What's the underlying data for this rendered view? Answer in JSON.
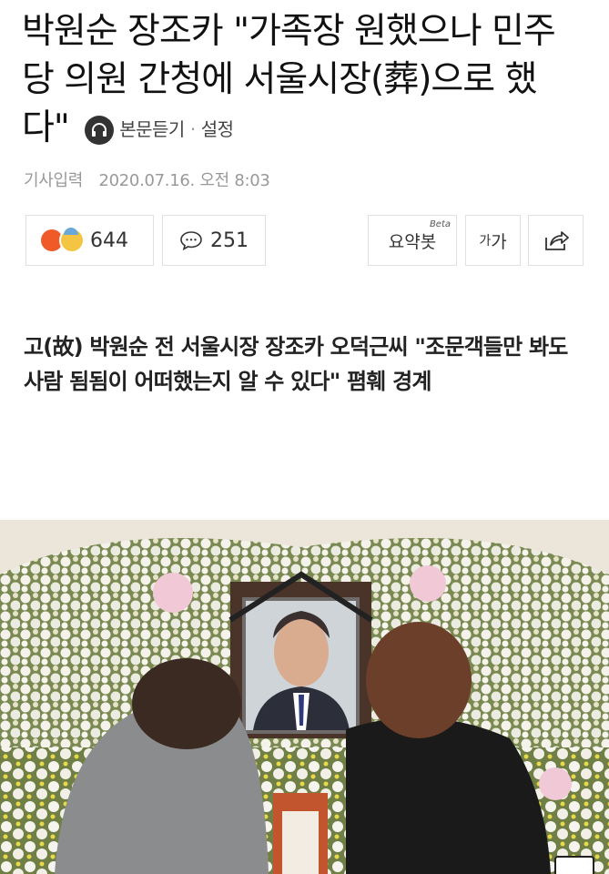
{
  "headline": {
    "line1": "박원순 장조카 \"가족장 원했으나 민주",
    "line2": "당 의원 간청에 서울시장(葬)으로 했",
    "line3": "다\"",
    "listen_label": "본문듣기",
    "dot": "·",
    "settings_label": "설정"
  },
  "meta": {
    "published_label": "기사입력",
    "published_date": "2020.07.16. 오전 8:03"
  },
  "actions": {
    "reaction_count": "644",
    "comment_count": "251",
    "summary_label": "요약봇",
    "summary_badge": "Beta",
    "fontsize_small": "가",
    "fontsize_large": "가"
  },
  "article": {
    "subtitle": "고(故) 박원순 전 서울시장 장조카 오덕근씨 \"조문객들만 봐도 사람 됨됨이 어떠했는지 알 수 있다\" 폄훼 경계"
  },
  "icons": {
    "listen": "headphones-icon",
    "comment": "speech-bubble-icon",
    "share": "share-icon"
  }
}
